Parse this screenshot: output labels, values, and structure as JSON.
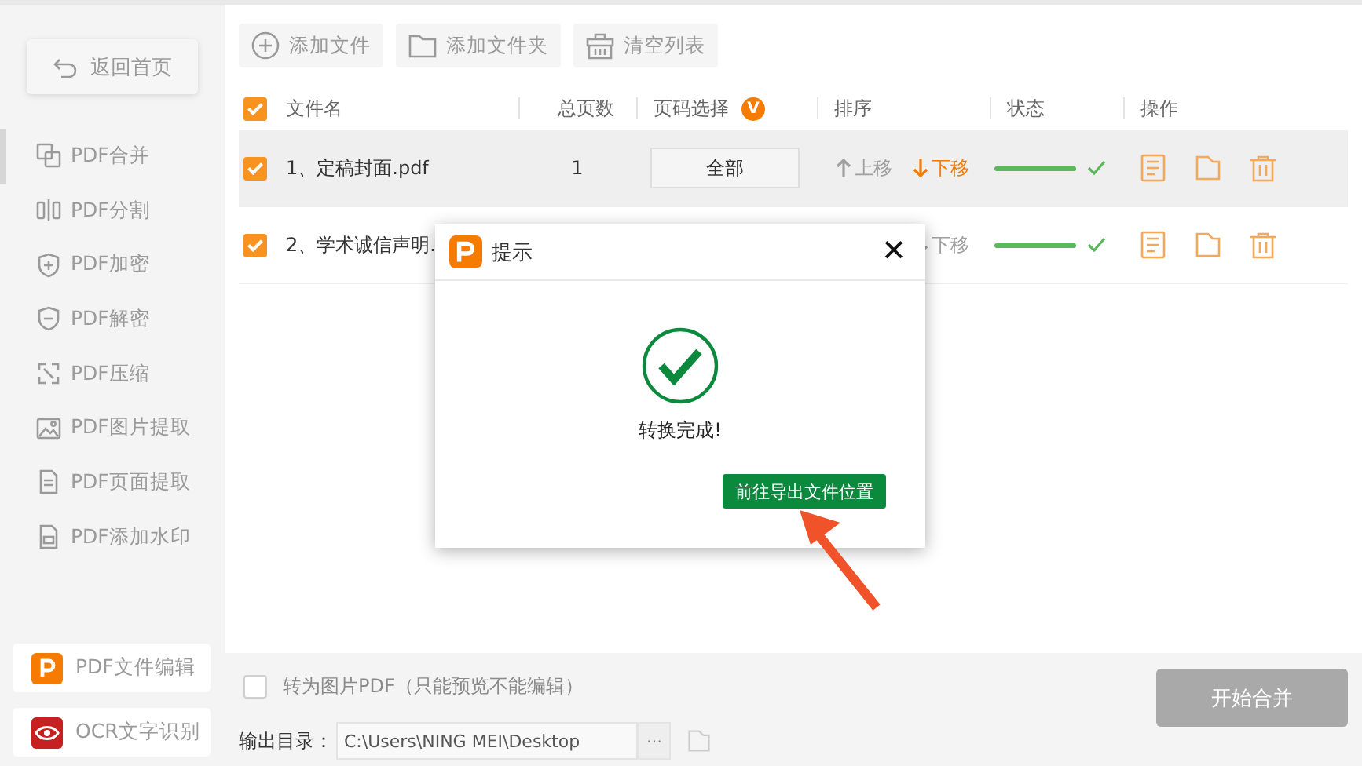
{
  "sidebar": {
    "back_button": "返回首页",
    "items": [
      {
        "label": "PDF合并",
        "selected": true
      },
      {
        "label": "PDF分割",
        "selected": false
      },
      {
        "label": "PDF加密",
        "selected": false
      },
      {
        "label": "PDF解密",
        "selected": false
      },
      {
        "label": "PDF压缩",
        "selected": false
      },
      {
        "label": "PDF图片提取",
        "selected": false
      },
      {
        "label": "PDF页面提取",
        "selected": false
      },
      {
        "label": "PDF添加水印",
        "selected": false
      }
    ],
    "app_buttons": [
      {
        "label": "PDF文件编辑"
      },
      {
        "label": "OCR文字识别"
      }
    ]
  },
  "toolbar": [
    {
      "label": "添加文件"
    },
    {
      "label": "添加文件夹"
    },
    {
      "label": "清空列表"
    }
  ],
  "table": {
    "select_all": {
      "checked": true
    },
    "columns": [
      {
        "label": "文件名"
      },
      {
        "label": "总页数"
      },
      {
        "label": "页码选择",
        "badge": "V"
      },
      {
        "label": "排序"
      },
      {
        "label": "状态"
      },
      {
        "label": "操作"
      }
    ],
    "rows": [
      {
        "checked": true,
        "selected": true,
        "name": "1、定稿封面.pdf",
        "pages": "1",
        "page_select": "全部",
        "move_up": {
          "label": "上移",
          "disabled": true
        },
        "move_down": {
          "label": "下移",
          "disabled": false
        },
        "progress": {
          "level": 1,
          "done": true
        }
      },
      {
        "checked": true,
        "selected": false,
        "name": "2、学术诚信声明.",
        "page_select": "",
        "move_down": {
          "label": "下移",
          "disabled": true
        },
        "progress": {
          "level": 1,
          "done": true
        }
      }
    ]
  },
  "options": {
    "image_pdf": {
      "label": "转为图片PDF（只能预览不能编辑）",
      "checked": false
    },
    "output_label": "输出目录：",
    "output_path": "C:\\Users\\NING MEI\\Desktop",
    "browse_button": "···"
  },
  "start_button": "开始合并",
  "dialog": {
    "title": "提示",
    "message": "转换完成!",
    "action_button": "前往导出文件位置",
    "close": "✕"
  }
}
